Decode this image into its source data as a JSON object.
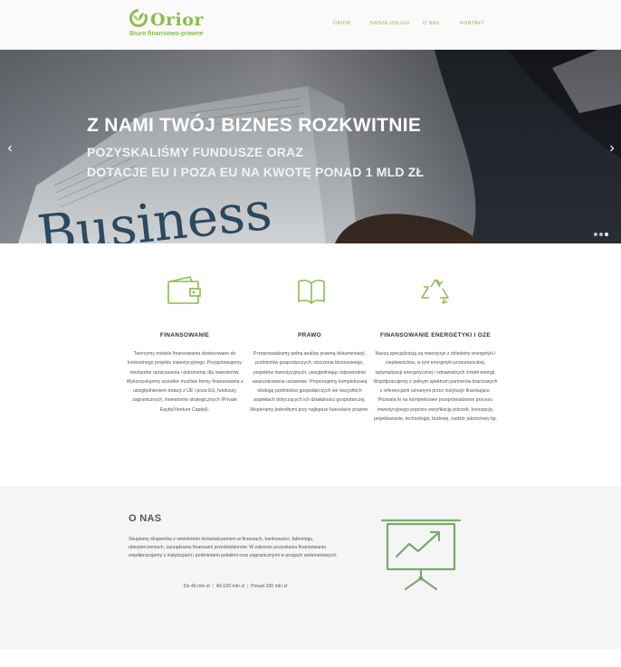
{
  "brand": {
    "name": "Orior",
    "subtitle": "Biuro finansowo-prawne",
    "accent_color": "#8bbd4a",
    "logo_icon": "leaf-logo-icon"
  },
  "nav": {
    "items": [
      {
        "label": "ORIOR"
      },
      {
        "label": "NASZE USŁUGI"
      },
      {
        "label": "O NAS"
      },
      {
        "label": "KONTAKT"
      }
    ]
  },
  "hero": {
    "title": "Z NAMI TWÓJ BIZNES ROZKWITNIE",
    "line1": "POZYSKALIŚMY FUNDUSZE ORAZ",
    "line2": "DOTACJE EU I POZA EU NA KWOTĘ PONAD 1 MLD ZŁ",
    "background_word": "Business",
    "prev_icon": "chevron-left-icon",
    "next_icon": "chevron-right-icon",
    "prev_glyph": "‹",
    "next_glyph": "›",
    "slides_total": 3,
    "active_slide": 3
  },
  "services": [
    {
      "icon": "wallet-icon",
      "title": "FINANSOWANIE",
      "text": "Tworzymy modele finansowania dostosowane do konkretnego projektu inwestycyjnego. Przygotowujemy niezbędne opracowania i dokumenty dla inwestorów. Wykorzystujemy wszelkie możliwe formy finansowania z uwzględnieniem dotacji z UE i poza EU, funduszy zagranicznych, inwestorów strategicznych (Private Equity/Venture Capital)."
    },
    {
      "icon": "book-icon",
      "title": "PRAWO",
      "text": "Przeprowadzamy pełną analizę prawną dokumentacji, podmiotów gospodarczych, otoczenia biznesowego, projektów inwestycyjnych, uwzględniając odpowiednie uwarunkowania ustawowe. Proponujemy kompleksową obsługę podmiotów gospodarczych we wszystkich aspektach dotyczących ich działalności gospodarczej. Wspieramy jednolitymi przy najlepsze kancelarie prawne."
    },
    {
      "icon": "recycle-icon",
      "title": "FINANSOWANIE ENERGETYKI I OZE",
      "text": "Naszą specjalizacją są inwestycje z dziedziny energetyki i ciepłownictwa, w tym energetyki prosumenckiej, optymalizacji energetycznej i odnawialnych źródeł energii. Współpracujemy z pełnym spektrum partnerów branżowych z referencjami uznanymi przez instytucje finansujące. Pozwala to na kompleksowe przeprowadzenie procesu inwestycyjnego poprzez weryfikację potrzeb, koncepcję, projektowanie, technologię, budowę, nadzór jakościowy itp."
    }
  ],
  "about": {
    "title": "O NAS",
    "text": "Skupiamy ekspertów z wieloletnim doświadczeniem w finansach, bankowości, faktoringu, ubezpieczeniach, zarządzaniu finansami przedsiębiorstw. W zakresie pozyskania finansowania współpracujemy z instytucjami i podmiotami polskimi oraz zagranicznymi w progach wolumenowych:",
    "ranges": [
      "Do 40 mln zł",
      "40-100 mln zł",
      "Ponad 100 mln zł"
    ],
    "range_separator": "|",
    "icon": "presentation-chart-icon"
  }
}
